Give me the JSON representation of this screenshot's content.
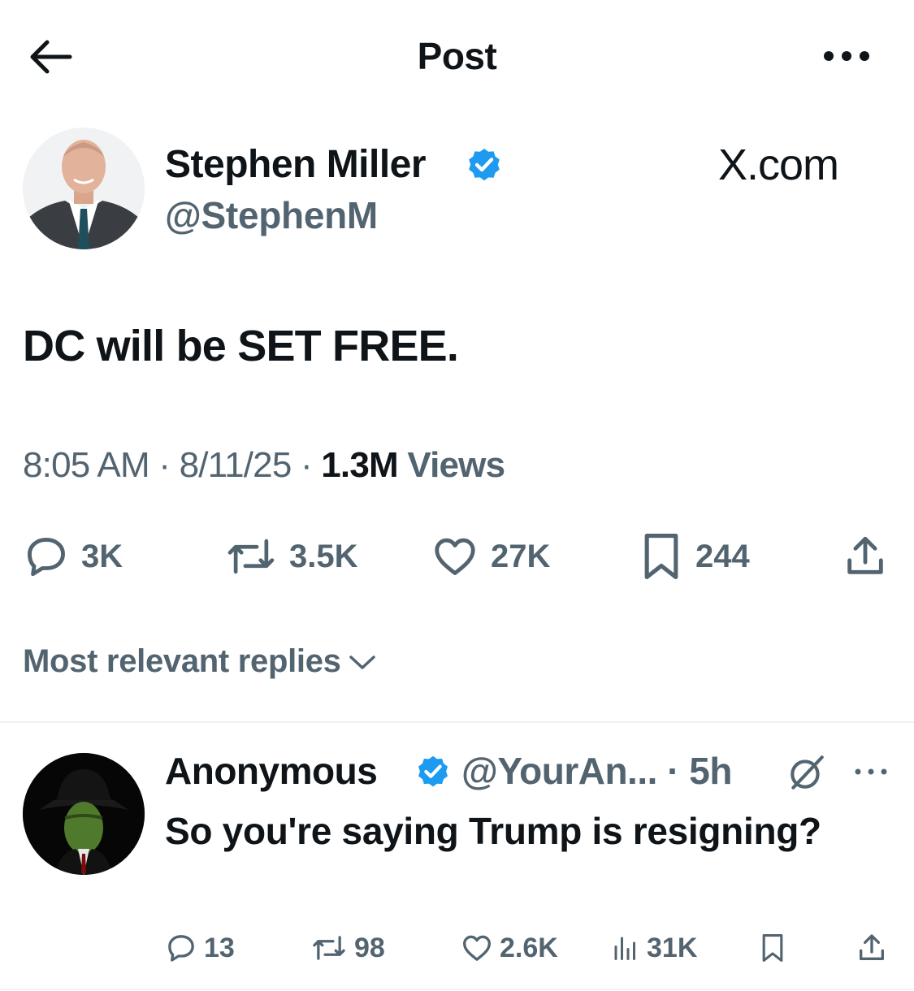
{
  "header": {
    "title": "Post"
  },
  "post": {
    "author_name": "Stephen Miller",
    "author_handle": "@StephenM",
    "source_label": "X.com",
    "text": "DC will be SET FREE.",
    "time": "8:05 AM",
    "date": "8/11/25",
    "views_count": "1.3M",
    "views_label": "Views",
    "separator": "·",
    "stats": {
      "replies": "3K",
      "reposts": "3.5K",
      "likes": "27K",
      "bookmarks": "244"
    }
  },
  "replies_sort": {
    "label": "Most relevant replies"
  },
  "reply": {
    "author_name": "Anonymous",
    "author_handle": "@YourAn...",
    "time": "· 5h",
    "text": "So you're saying Trump is resigning?",
    "stats": {
      "replies": "13",
      "reposts": "98",
      "likes": "2.6K",
      "views": "31K"
    }
  },
  "colors": {
    "text": "#0f1419",
    "secondary": "#536471",
    "verified": "#1d9bf0",
    "divider": "#eff3f4"
  }
}
